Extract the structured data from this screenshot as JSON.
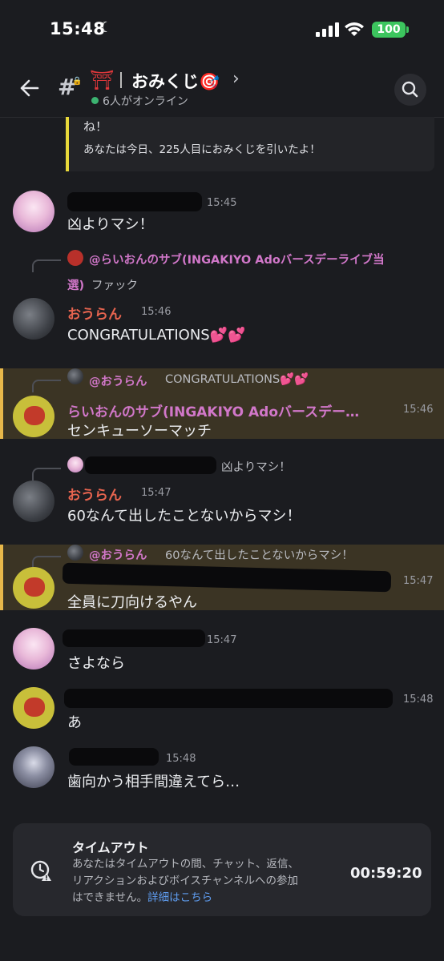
{
  "status_bar": {
    "time": "15:48",
    "battery": "100"
  },
  "header": {
    "channel_name": "おみくじ🎯",
    "online": "6人がオンライン"
  },
  "embed": {
    "line1": "ね！",
    "line2": "あなたは今日、225人目におみくじを引いたよ！"
  },
  "messages": [
    {
      "time": "15:45",
      "text": "凶よりマシ！"
    },
    {
      "reply_name": "@らいおんのサブ(INGAKIYO Adoバースデーライブ当",
      "reply_cont": "選)",
      "reply_text": "ファック",
      "name": "おうらん",
      "time": "15:46",
      "text": "CONGRATULATIONS💕💕"
    },
    {
      "reply_name": "@おうらん",
      "reply_text": "CONGRATULATIONS💕💕",
      "name": "らいおんのサブ(INGAKIYO Adoバースデー…",
      "time": "15:46",
      "text": "センキューソーマッチ"
    },
    {
      "reply_text": "凶よりマシ！",
      "name": "おうらん",
      "time": "15:47",
      "text": "60なんて出したことないからマシ！"
    },
    {
      "reply_name": "@おうらん",
      "reply_text": "60なんて出したことないからマシ！",
      "time": "15:47",
      "text": "全員に刀向けるやん"
    },
    {
      "time": "15:47",
      "text": "さよなら"
    },
    {
      "time": "15:48",
      "text": "あ"
    },
    {
      "time": "15:48",
      "text": "歯向かう相手間違えてら…"
    }
  ],
  "timeout": {
    "title": "タイムアウト",
    "line1": "あなたはタイムアウトの間、チャット、返信、",
    "line2": "リアクションおよびボイスチャンネルへの参加",
    "line3": "はできません。",
    "link": "詳細はこちら",
    "remaining": "00:59:20"
  },
  "colors": {
    "background": "#1b1c20",
    "username_pink": "#d177c9",
    "username_red": "#e7644f",
    "highlight_bg": "#3b3424",
    "embed_border": "#e8d83a",
    "link_blue": "#5f9df0"
  },
  "icons": [
    "back-arrow-icon",
    "hash-lock-icon",
    "torii-icon",
    "chevron-right-icon",
    "search-icon",
    "timeout-clock-icon"
  ]
}
